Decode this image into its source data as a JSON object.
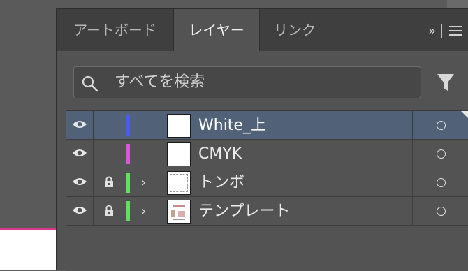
{
  "panel": {
    "tabs": [
      {
        "label": "アートボード",
        "active": false
      },
      {
        "label": "レイヤー",
        "active": true
      },
      {
        "label": "リンク",
        "active": false
      }
    ],
    "expand_glyph": "»",
    "menu_icon": "hamburger-menu-icon"
  },
  "search": {
    "placeholder": "すべてを検索",
    "icon": "search-icon",
    "filter_icon": "filter-icon"
  },
  "layers": [
    {
      "name": "White_上",
      "visible": true,
      "locked": false,
      "expandable": false,
      "color": "#4a5cf0",
      "selected": true
    },
    {
      "name": "CMYK",
      "visible": true,
      "locked": false,
      "expandable": false,
      "color": "#d65ad8",
      "selected": false
    },
    {
      "name": "トンボ",
      "visible": true,
      "locked": true,
      "expandable": true,
      "color": "#5fe05f",
      "selected": false
    },
    {
      "name": "テンプレート",
      "visible": true,
      "locked": true,
      "expandable": true,
      "color": "#5fe05f",
      "selected": false
    }
  ],
  "colors": {
    "selection": "#506178",
    "artboard_edge": "#d9358b"
  }
}
